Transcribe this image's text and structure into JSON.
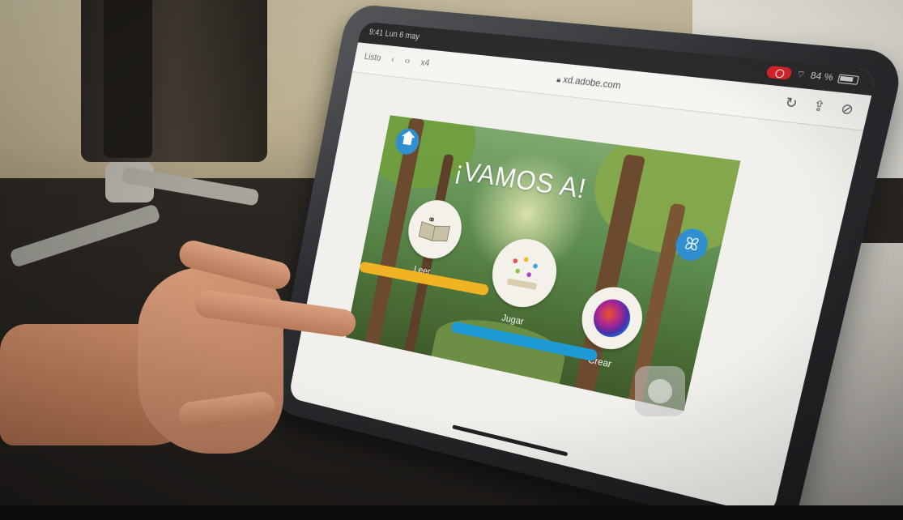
{
  "browser": {
    "status_time": "9:41  Lun 6 may",
    "battery": "84 %",
    "battery_level": 0.84,
    "url": "xd.adobe.com",
    "nav_left": [
      "Listo",
      "‹",
      "‹›",
      "x4"
    ]
  },
  "app": {
    "title": "¡VAMOS A!",
    "options": [
      {
        "label": "Leer",
        "icon": "book-glasses-icon"
      },
      {
        "label": "Jugar",
        "icon": "book-confetti-icon"
      },
      {
        "label": "Crear",
        "icon": "paint-splash-icon"
      }
    ],
    "colors": {
      "home_button": "#2f8fd0",
      "bar_yellow": "#f0b323",
      "bar_blue": "#1e9ad6"
    }
  }
}
